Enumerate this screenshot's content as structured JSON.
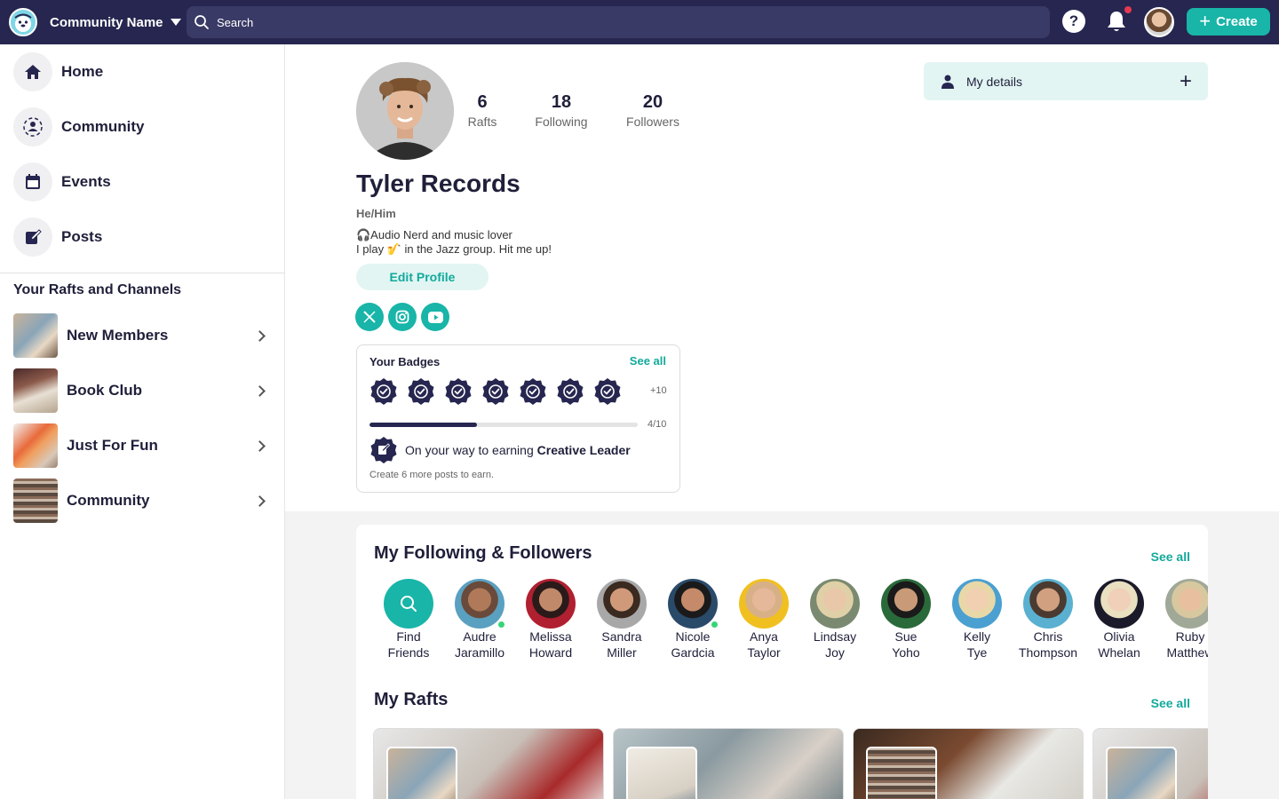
{
  "topbar": {
    "community_name": "Community Name",
    "search_placeholder": "Search",
    "help_label": "?",
    "create_label": "Create"
  },
  "sidebar": {
    "nav": [
      {
        "label": "Home",
        "icon": "home-icon"
      },
      {
        "label": "Community",
        "icon": "community-icon"
      },
      {
        "label": "Events",
        "icon": "calendar-icon"
      },
      {
        "label": "Posts",
        "icon": "edit-post-icon"
      }
    ],
    "rafts_heading": "Your Rafts and Channels",
    "rafts": [
      {
        "name": "New Members"
      },
      {
        "name": "Book Club"
      },
      {
        "name": "Just For Fun"
      },
      {
        "name": "Community"
      }
    ]
  },
  "profile": {
    "stats": [
      {
        "value": "6",
        "label": "Rafts"
      },
      {
        "value": "18",
        "label": "Following"
      },
      {
        "value": "20",
        "label": "Followers"
      }
    ],
    "name": "Tyler Records",
    "pronouns": "He/Him",
    "bio_line1": "🎧Audio Nerd and music lover",
    "bio_line2": "I play 🎷 in the Jazz group. Hit me up!",
    "edit_label": "Edit Profile",
    "socials": [
      "x-icon",
      "instagram-icon",
      "youtube-icon"
    ]
  },
  "badges": {
    "title": "Your Badges",
    "see_all": "See all",
    "earned_count": 7,
    "more": "+10",
    "progress_label": "4/10",
    "progress_fraction": 0.4,
    "goal_prefix": "On your way to earning ",
    "goal_name": "Creative Leader",
    "goal_sub": "Create 6 more posts to earn."
  },
  "details": {
    "label": "My details"
  },
  "following": {
    "title": "My Following & Followers",
    "see_all": "See all",
    "find_line1": "Find",
    "find_line2": "Friends",
    "people": [
      {
        "first": "Audre",
        "last": "Jaramillo",
        "online": true
      },
      {
        "first": "Melissa",
        "last": "Howard",
        "online": false
      },
      {
        "first": "Sandra",
        "last": "Miller",
        "online": false
      },
      {
        "first": "Nicole",
        "last": "Gardcia",
        "online": true
      },
      {
        "first": "Anya",
        "last": "Taylor",
        "online": false
      },
      {
        "first": "Lindsay",
        "last": "Joy",
        "online": false
      },
      {
        "first": "Sue",
        "last": "Yoho",
        "online": false
      },
      {
        "first": "Kelly",
        "last": "Tye",
        "online": false
      },
      {
        "first": "Chris",
        "last": "Thompson",
        "online": false
      },
      {
        "first": "Olivia",
        "last": "Whelan",
        "online": false
      },
      {
        "first": "Ruby",
        "last": "Matthew",
        "online": false
      }
    ]
  },
  "my_rafts": {
    "title": "My Rafts",
    "see_all": "See all"
  },
  "colors": {
    "navy": "#262650",
    "teal": "#18b5a8",
    "teal_light": "#e2f5f3",
    "online": "#38d47a",
    "notification": "#e53950"
  }
}
